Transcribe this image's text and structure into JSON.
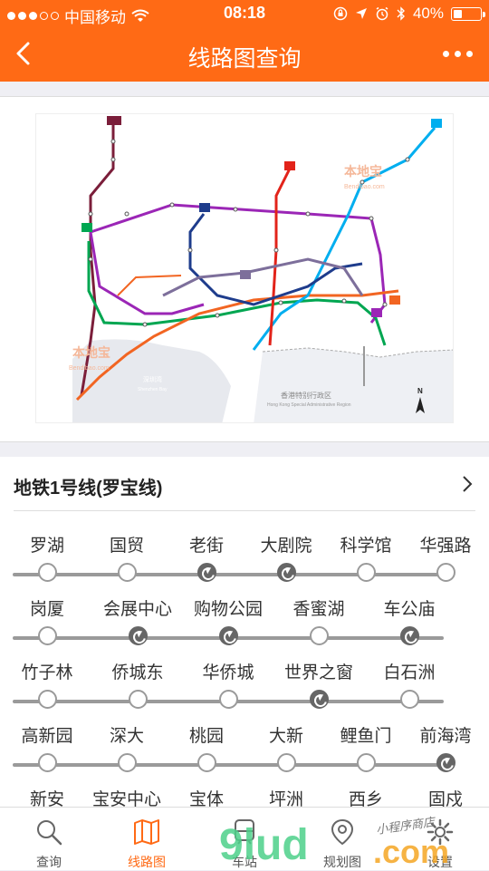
{
  "status_bar": {
    "carrier": "中国移动",
    "time": "08:18",
    "battery": "40%",
    "battery_level": 0.4,
    "signal_bars_filled": 3,
    "icons": [
      "wifi-icon",
      "rotation-lock-icon",
      "location-arrow-icon",
      "alarm-icon",
      "bluetooth-icon",
      "battery-icon"
    ]
  },
  "nav": {
    "title": "线路图查询",
    "back_icon": "back-chevron-icon",
    "more_icon": "more-icon"
  },
  "map": {
    "city_label": "香港特别行政区",
    "city_label_en": "Hong Kong Special Administrative Region",
    "bay_label": "深圳湾",
    "bay_label_en": "Shenzhen Bay",
    "watermark": "本地宝",
    "watermark_en": "Bendibao.com",
    "compass": "N",
    "line_badges": [
      "1",
      "2",
      "3",
      "4",
      "5",
      "7",
      "9",
      "11"
    ]
  },
  "line": {
    "title": "地铁1号线(罗宝线)",
    "rows": [
      {
        "stations": [
          {
            "name": "罗湖",
            "transfer": false
          },
          {
            "name": "国贸",
            "transfer": false
          },
          {
            "name": "老街",
            "transfer": true
          },
          {
            "name": "大剧院",
            "transfer": true
          },
          {
            "name": "科学馆",
            "transfer": false
          },
          {
            "name": "华强路",
            "transfer": false
          }
        ]
      },
      {
        "stations": [
          {
            "name": "岗厦",
            "transfer": false
          },
          {
            "name": "会展中心",
            "transfer": true
          },
          {
            "name": "购物公园",
            "transfer": true
          },
          {
            "name": "香蜜湖",
            "transfer": false
          },
          {
            "name": "车公庙",
            "transfer": true
          }
        ]
      },
      {
        "stations": [
          {
            "name": "竹子林",
            "transfer": false
          },
          {
            "name": "侨城东",
            "transfer": false
          },
          {
            "name": "华侨城",
            "transfer": false
          },
          {
            "name": "世界之窗",
            "transfer": true
          },
          {
            "name": "白石洲",
            "transfer": false
          }
        ]
      },
      {
        "stations": [
          {
            "name": "高新园",
            "transfer": false
          },
          {
            "name": "深大",
            "transfer": false
          },
          {
            "name": "桃园",
            "transfer": false
          },
          {
            "name": "大新",
            "transfer": false
          },
          {
            "name": "鲤鱼门",
            "transfer": false
          },
          {
            "name": "前海湾",
            "transfer": true
          }
        ]
      },
      {
        "stations": [
          {
            "name": "新安",
            "transfer": false
          },
          {
            "name": "宝安中心",
            "transfer": false
          },
          {
            "name": "宝体",
            "transfer": false
          },
          {
            "name": "坪洲",
            "transfer": false
          },
          {
            "name": "西乡",
            "transfer": false
          },
          {
            "name": "固戍",
            "transfer": false
          }
        ]
      }
    ]
  },
  "tabs": [
    {
      "label": "查询",
      "icon": "search-icon",
      "active": false
    },
    {
      "label": "线路图",
      "icon": "map-icon",
      "active": true
    },
    {
      "label": "车站",
      "icon": "station-icon",
      "active": false
    },
    {
      "label": "规划图",
      "icon": "plan-icon",
      "active": false
    },
    {
      "label": "设置",
      "icon": "gear-icon",
      "active": false
    }
  ],
  "overlay_watermark": {
    "brand": "9lud",
    "domain": ".com",
    "handwriting": "小程序商店"
  },
  "colors": {
    "accent": "#ff6a15",
    "line1": "#00a651",
    "line2": "#f26522",
    "line3": "#00aeef",
    "line4": "#e2231a",
    "line5": "#9b26b6",
    "line7": "#1e3c8c",
    "line9": "#7d6f9b",
    "line11": "#7b1e3a",
    "track": "#9a9a9a"
  }
}
